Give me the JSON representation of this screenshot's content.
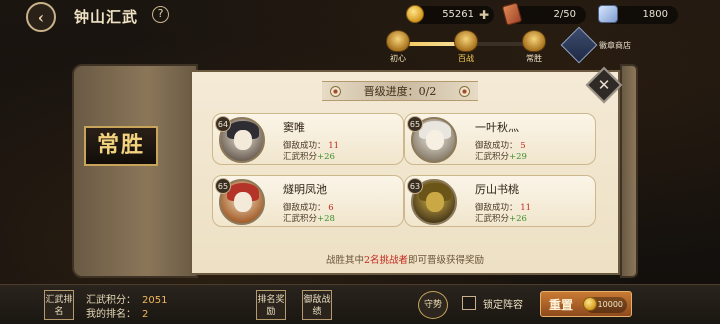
{
  "header": {
    "title": "钟山汇武",
    "back_icon": "back-arrow-icon",
    "help_icon": "?"
  },
  "resources": [
    {
      "name": "coin",
      "value": "55261",
      "has_plus": true
    },
    {
      "name": "ticket",
      "value": "2/50",
      "has_plus": false
    },
    {
      "name": "gem",
      "value": "1800",
      "has_plus": false
    }
  ],
  "tiers": [
    {
      "label": "初心"
    },
    {
      "label": "百战"
    },
    {
      "label": "常胜"
    }
  ],
  "badge_shop_label": "徽章商店",
  "rank_plate": "常胜",
  "progress_text": "晋级进度：0/2",
  "cards": [
    {
      "level": "64",
      "name": "窦唯",
      "defense_label": "御敌成功：",
      "defense_value": "11",
      "score_label": "汇武积分",
      "score_value": "+26"
    },
    {
      "level": "65",
      "name": "一叶秋灬",
      "defense_label": "御敌成功：",
      "defense_value": "5",
      "score_label": "汇武积分",
      "score_value": "+29"
    },
    {
      "level": "65",
      "name": "燧明凤池",
      "defense_label": "御敌成功：",
      "defense_value": "6",
      "score_label": "汇武积分",
      "score_value": "+28"
    },
    {
      "level": "63",
      "name": "厉山书桃",
      "defense_label": "御敌成功：",
      "defense_value": "11",
      "score_label": "汇武积分",
      "score_value": "+26"
    }
  ],
  "footer_note": {
    "prefix": "战胜其中",
    "highlight": "2名挑战者",
    "suffix": "即可晋级获得奖励"
  },
  "bottom": {
    "rank_btn": "汇武排名",
    "score_label": "汇武积分：",
    "score_value": "2051",
    "myrank_label": "我的排名：",
    "myrank_value": "2",
    "reward_btn": "排名奖励",
    "record_btn": "御敌战绩",
    "guard_btn": "守势",
    "lock_label": "锁定阵容",
    "reset_label": "重置",
    "reset_cost": "10000"
  },
  "colors": {
    "accent_gold": "#f4d37e",
    "highlight_red": "#c2281f",
    "score_green": "#3a8f2c"
  }
}
